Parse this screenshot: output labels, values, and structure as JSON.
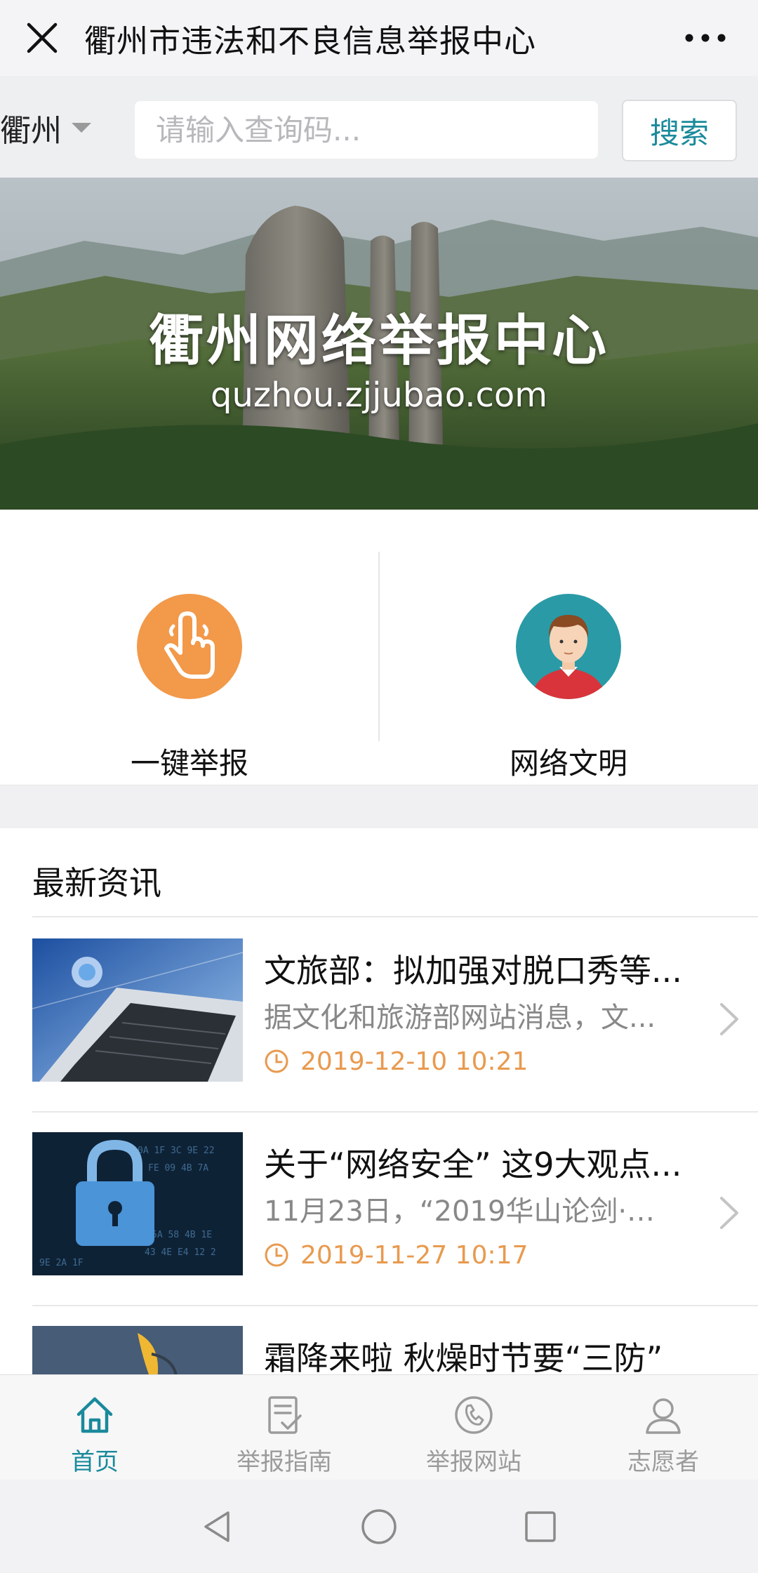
{
  "window": {
    "title": "衢州市违法和不良信息举报中心",
    "close_icon": "close-icon",
    "more_icon": "more-dots-icon"
  },
  "search": {
    "city": "衢州",
    "placeholder": "请输入查询码...",
    "button_label": "搜索",
    "accent_color": "#1a8a9b"
  },
  "banner": {
    "title": "衢州网络举报中心",
    "url": "quzhou.zjjubao.com"
  },
  "quick_actions": [
    {
      "label": "一键举报",
      "icon": "tap-finger-icon",
      "color": "#f2994a"
    },
    {
      "label": "网络文明",
      "icon": "person-avatar-icon",
      "color": "#2a9aa6"
    }
  ],
  "news": {
    "section_title": "最新资讯",
    "items": [
      {
        "title": "文旅部：拟加强对脱口秀等...",
        "summary": "据文化和旅游部网站消息，文...",
        "time": "2019-12-10 10:21",
        "thumb": "laptop-image"
      },
      {
        "title": "关于“网络安全” 这9大观点...",
        "summary": "11月23日，“2019华山论剑·网...",
        "time": "2019-11-27 10:17",
        "thumb": "padlock-image"
      },
      {
        "title": "霜降来啦 秋燥时节要“三防”",
        "summary": "",
        "time": "",
        "thumb": "leaves-image"
      }
    ],
    "time_color": "#e89a4f"
  },
  "tabs": [
    {
      "label": "首页",
      "icon": "home-icon",
      "active": true
    },
    {
      "label": "举报指南",
      "icon": "guide-doc-icon",
      "active": false
    },
    {
      "label": "举报网站",
      "icon": "globe-phone-icon",
      "active": false
    },
    {
      "label": "志愿者",
      "icon": "user-icon",
      "active": false
    }
  ]
}
